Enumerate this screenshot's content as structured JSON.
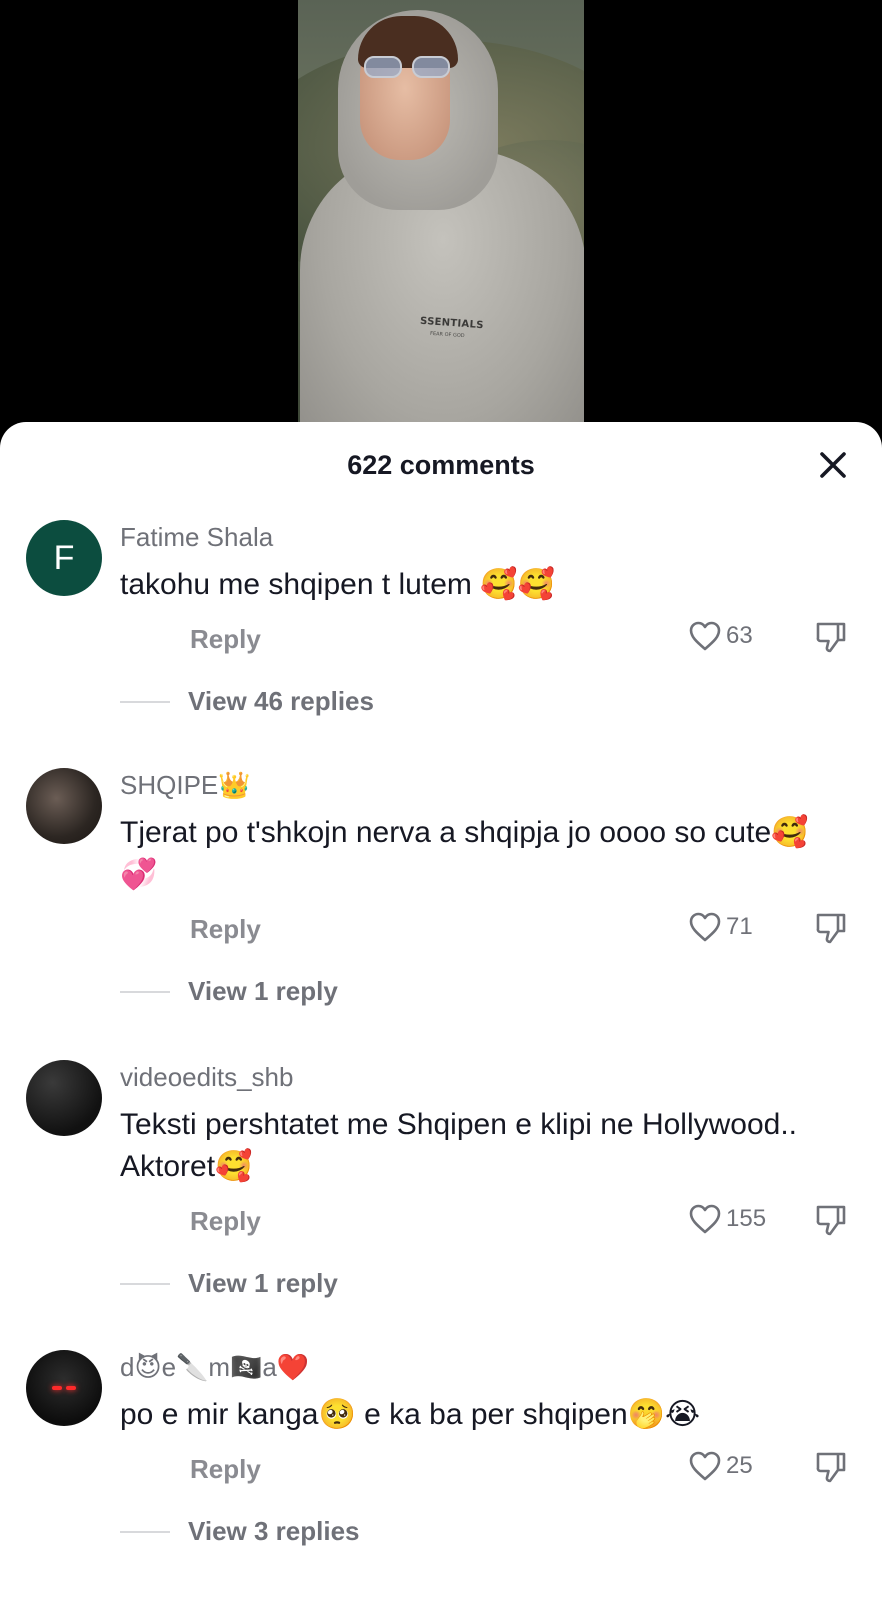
{
  "video": {
    "hoodie_text": "SSENTIALS",
    "hoodie_subtext": "FEAR OF GOD"
  },
  "sheet": {
    "title": "622 comments"
  },
  "comments": [
    {
      "username": "Fatime Shala",
      "avatar_letter": "F",
      "text": "takohu me shqipen t lutem 🥰🥰",
      "reply_label": "Reply",
      "likes": "63",
      "view_replies": "View 46 replies"
    },
    {
      "username": "SHQIPE👑",
      "text": "Tjerat po t'shkojn nerva a shqipja jo oooo so cute🥰💞",
      "reply_label": "Reply",
      "likes": "71",
      "view_replies": "View 1 reply"
    },
    {
      "username": "videoedits_shb",
      "text": "Teksti pershtatet me Shqipen e klipi ne Hollywood.. Aktoret🥰",
      "reply_label": "Reply",
      "likes": "155",
      "view_replies": "View 1 reply"
    },
    {
      "username": "d😈e🔪m🏴‍☠️a❤️",
      "text": "po e mir kanga🥺 e ka ba per shqipen🤭😭",
      "reply_label": "Reply",
      "likes": "25",
      "view_replies": "View 3 replies"
    }
  ],
  "icons": {
    "close": "close-icon",
    "like": "heart-outline-icon",
    "dislike": "thumbs-down-icon"
  },
  "colors": {
    "avatar_green": "#0c4d3f",
    "text_primary": "#161823",
    "text_secondary": "#6f7178"
  }
}
